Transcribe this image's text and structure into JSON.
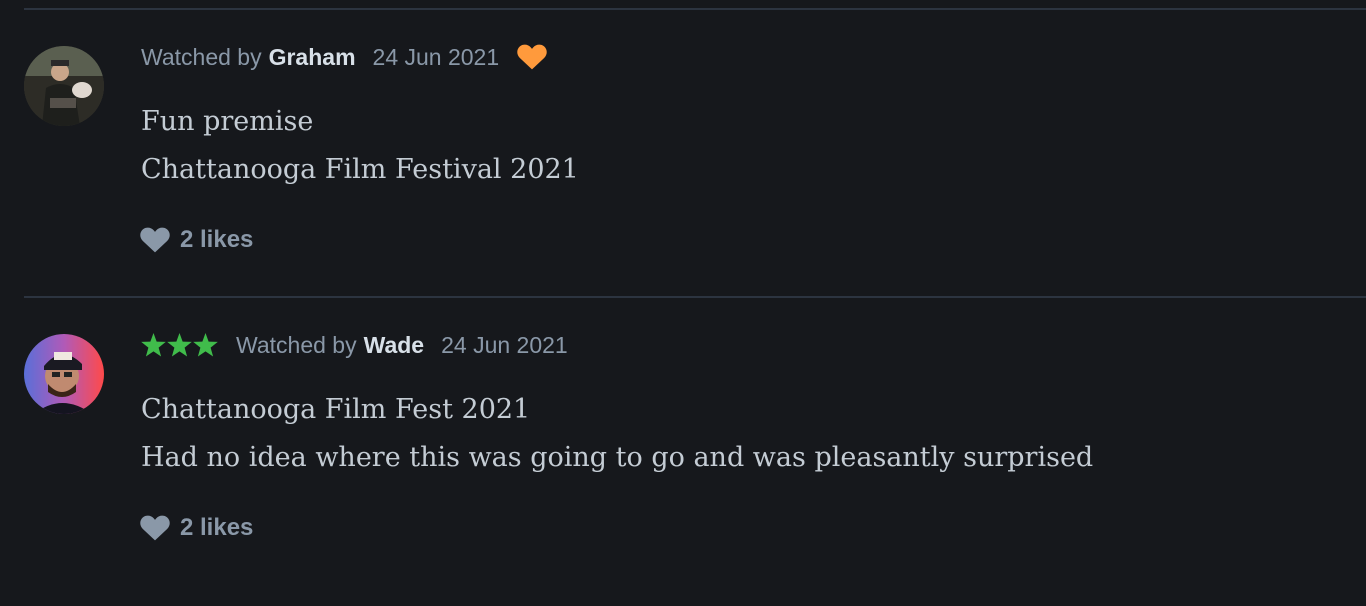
{
  "colors": {
    "background": "#16181c",
    "liked_heart": "#ff9a3c",
    "star": "#40bc4b",
    "like_icon": "#8a98a8"
  },
  "reviews": [
    {
      "watched_prefix": "Watched by",
      "user": "Graham",
      "date": "24 Jun 2021",
      "rating_stars": 0,
      "liked": true,
      "lines": [
        "Fun premise",
        "Chattanooga Film Festival 2021"
      ],
      "likes_label": "2 likes",
      "avatar_icon": "user-avatar-graham"
    },
    {
      "watched_prefix": "Watched by",
      "user": "Wade",
      "date": "24 Jun 2021",
      "rating_stars": 3,
      "liked": false,
      "lines": [
        "Chattanooga Film Fest 2021",
        "Had no idea where this was going to go and was pleasantly surprised"
      ],
      "likes_label": "2 likes",
      "avatar_icon": "user-avatar-wade"
    }
  ]
}
